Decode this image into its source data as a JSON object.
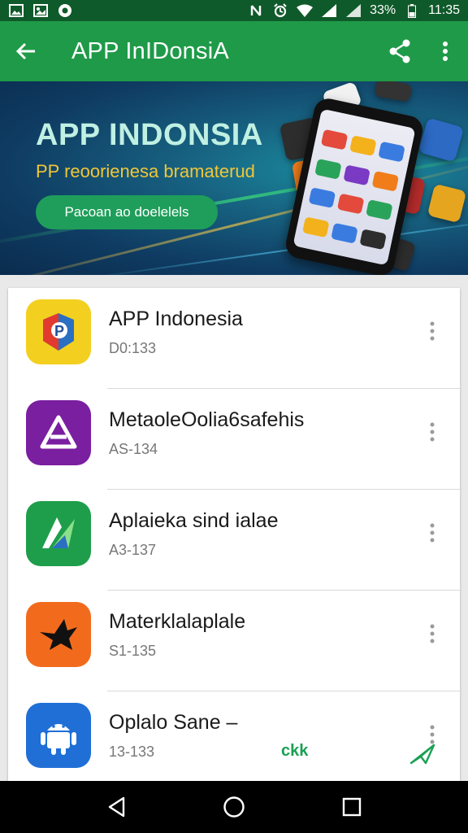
{
  "status_bar": {
    "battery": "33%",
    "time": "11:35",
    "left_icons": [
      "image-icon",
      "gallery-icon",
      "chrome-icon"
    ],
    "right_icons": [
      "nfc-icon",
      "alarm-icon",
      "wifi-icon",
      "signal-icon",
      "signal-icon",
      "battery-icon"
    ]
  },
  "toolbar": {
    "title": "APP InIDonsiA",
    "back_icon": "arrow-left-icon",
    "share_icon": "share-icon",
    "more_icon": "more-vert-icon",
    "color": "#1f9a48"
  },
  "banner": {
    "title": "APP INDONSIA",
    "subtitle": "PP reoorienesa bramaterud",
    "button": "Pacoan ao doelelels"
  },
  "apps": [
    {
      "name": "APP Indonesia",
      "meta": "D0:133",
      "icon": "app-indonesia-icon",
      "color": "#f3d01f"
    },
    {
      "name": "MetaoleOolia6safehis",
      "meta": "AS-134",
      "icon": "triangle-a-icon",
      "color": "#7a1fa0"
    },
    {
      "name": "Aplaieka sind ialae",
      "meta": "A3-137",
      "icon": "play-a-icon",
      "color": "#1e9e4a"
    },
    {
      "name": "Materklalaplale",
      "meta": "S1-135",
      "icon": "bird-icon",
      "color": "#f26b1d"
    },
    {
      "name": "Oplalo Sane –",
      "meta": "13-133",
      "icon": "android-icon",
      "color": "#1f6fd6"
    }
  ],
  "overlay": {
    "ok_label": "ckk"
  },
  "navbar": {
    "back": "back-nav-icon",
    "home": "home-nav-icon",
    "recents": "recents-nav-icon"
  }
}
